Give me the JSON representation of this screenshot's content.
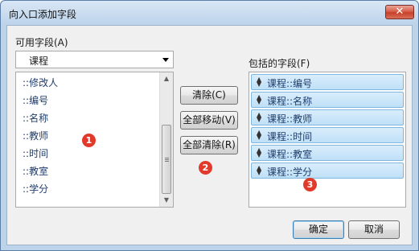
{
  "window": {
    "title": "向入口添加字段",
    "close_symbol": "✕"
  },
  "available": {
    "label": "可用字段(A)",
    "selected_table": "课程",
    "items": [
      "::修改人",
      "::编号",
      "::名称",
      "::教师",
      "::时间",
      "::教室",
      "::学分"
    ]
  },
  "buttons": {
    "clear": "清除(C)",
    "move_all": "全部移动(V)",
    "clear_all": "全部清除(R)",
    "ok": "确定",
    "cancel": "取消"
  },
  "included": {
    "label": "包括的字段(F)",
    "items": [
      "课程::编号",
      "课程::名称",
      "课程::教师",
      "课程::时间",
      "课程::教室",
      "课程::学分"
    ]
  },
  "annotations": [
    "1",
    "2",
    "3"
  ],
  "colors": {
    "badge": "#e23a2a",
    "selected_row": "#c9e6f9"
  }
}
